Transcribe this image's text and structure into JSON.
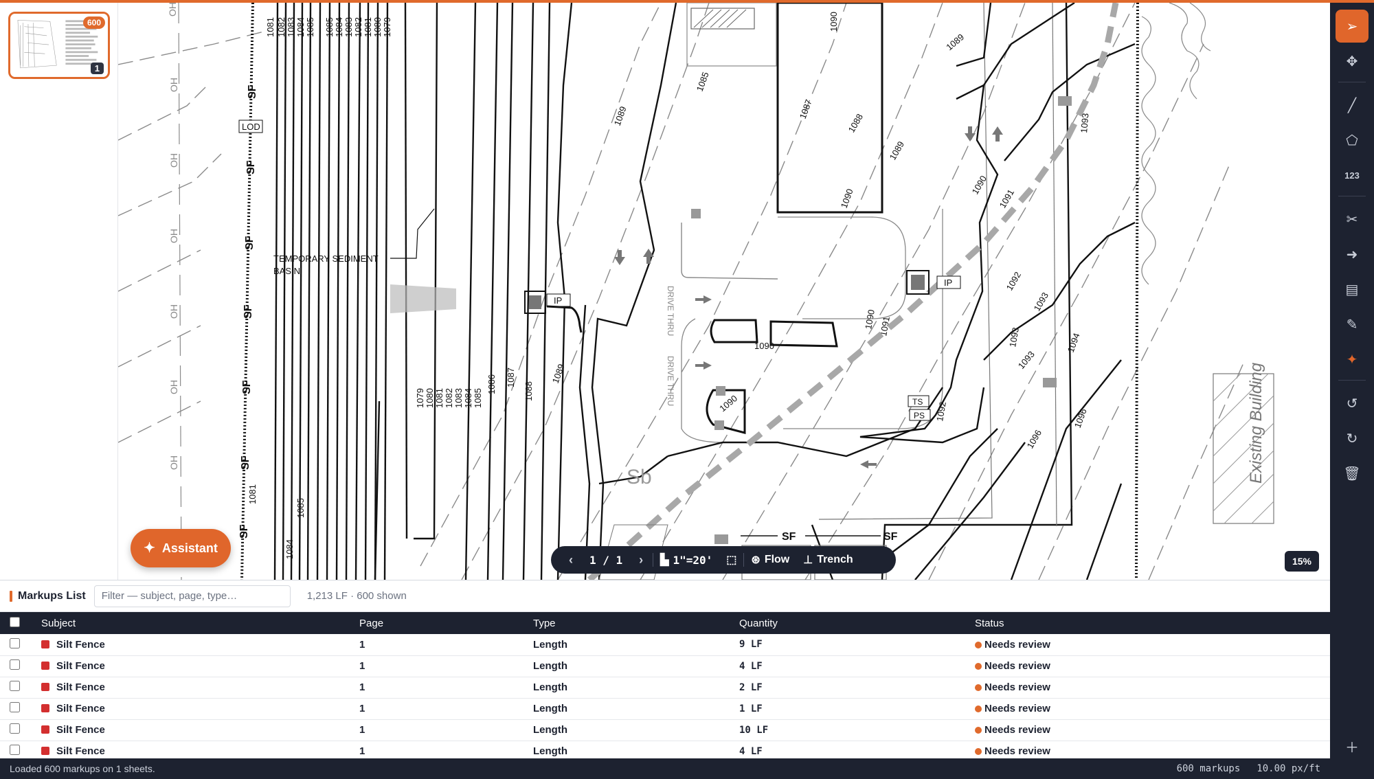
{
  "thumbnail": {
    "markup_count": "600",
    "page_number": "1"
  },
  "drawing": {
    "labels": {
      "lod": "LOD",
      "basin_line1": "TEMPORARY SEDIMENT",
      "basin_line2": "BASIN",
      "ip1": "IP",
      "ip2": "IP",
      "ts": "TS",
      "ps": "PS",
      "sb": "Sb",
      "drive_thru_1": "DRIVE THRU",
      "drive_thru_2": "DRIVE THRU",
      "existing_building": "Existing Building",
      "sf": "SF",
      "oh": "OH"
    },
    "contours": [
      "1079",
      "1080",
      "1081",
      "1082",
      "1083",
      "1084",
      "1085",
      "1086",
      "1087",
      "1088",
      "1089",
      "1090",
      "1091",
      "1092",
      "1093",
      "1094",
      "1096"
    ]
  },
  "assistant": {
    "label": "Assistant"
  },
  "navigator": {
    "page_indicator": "1 / 1",
    "scale": "1\"=20'",
    "flow_label": "Flow",
    "trench_label": "Trench"
  },
  "zoom": "15%",
  "toolbar": {
    "count_tool_label": "123"
  },
  "markups": {
    "title": "Markups List",
    "filter_placeholder": "Filter — subject, page, type…",
    "summary": "1,213 LF · 600 shown",
    "columns": [
      "Subject",
      "Page",
      "Type",
      "Quantity",
      "Status"
    ],
    "rows": [
      {
        "subject": "Silt Fence",
        "page": "1",
        "type": "Length",
        "quantity": "9 LF",
        "status": "Needs review"
      },
      {
        "subject": "Silt Fence",
        "page": "1",
        "type": "Length",
        "quantity": "4 LF",
        "status": "Needs review"
      },
      {
        "subject": "Silt Fence",
        "page": "1",
        "type": "Length",
        "quantity": "2 LF",
        "status": "Needs review"
      },
      {
        "subject": "Silt Fence",
        "page": "1",
        "type": "Length",
        "quantity": "1 LF",
        "status": "Needs review"
      },
      {
        "subject": "Silt Fence",
        "page": "1",
        "type": "Length",
        "quantity": "10 LF",
        "status": "Needs review"
      },
      {
        "subject": "Silt Fence",
        "page": "1",
        "type": "Length",
        "quantity": "4 LF",
        "status": "Needs review"
      }
    ]
  },
  "statusbar": {
    "message": "Loaded 600 markups on 1 sheets.",
    "markup_total": "600 markups",
    "scale_readout": "10.00 px/ft"
  },
  "colors": {
    "accent": "#e06a2c",
    "dark": "#1d2230",
    "silt_fence_swatch": "#d32f2f"
  }
}
